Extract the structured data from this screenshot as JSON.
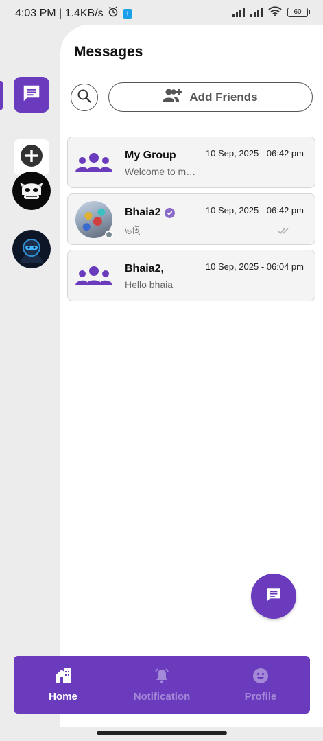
{
  "status_bar": {
    "time_speed": "4:03 PM | 1.4KB/s",
    "battery": "60",
    "icons": [
      "alarm-icon",
      "upload-icon",
      "signal-icon",
      "signal-icon",
      "wifi-icon",
      "battery-icon"
    ]
  },
  "rail": {
    "items": [
      {
        "name": "messages",
        "icon": "chat-icon",
        "active": true
      },
      {
        "name": "add-server",
        "icon": "plus-circle-icon"
      },
      {
        "name": "server-1",
        "icon": "server-avatar"
      },
      {
        "name": "server-2",
        "icon": "server-avatar"
      }
    ]
  },
  "main": {
    "title": "Messages",
    "add_friends_label": "Add Friends"
  },
  "chats": [
    {
      "name": "My Group",
      "time": "10 Sep, 2025 - 06:42 pm",
      "preview": "Welcome to my group",
      "avatar": "group-icon",
      "verified": false
    },
    {
      "name": "Bhaia2",
      "time": "10 Sep, 2025 - 06:42 pm",
      "preview": "ভাই",
      "avatar": "photo",
      "verified": true,
      "ticks": "double-check-icon"
    },
    {
      "name": "Bhaia2,",
      "time": "10 Sep, 2025 - 06:04 pm",
      "preview": "Hello bhaia",
      "avatar": "group-icon",
      "verified": false
    }
  ],
  "bottom_nav": {
    "home": "Home",
    "notification": "Notification",
    "profile": "Profile"
  },
  "colors": {
    "accent": "#6a3bbd",
    "accent_light": "#a489d8",
    "background": "#ececec"
  }
}
